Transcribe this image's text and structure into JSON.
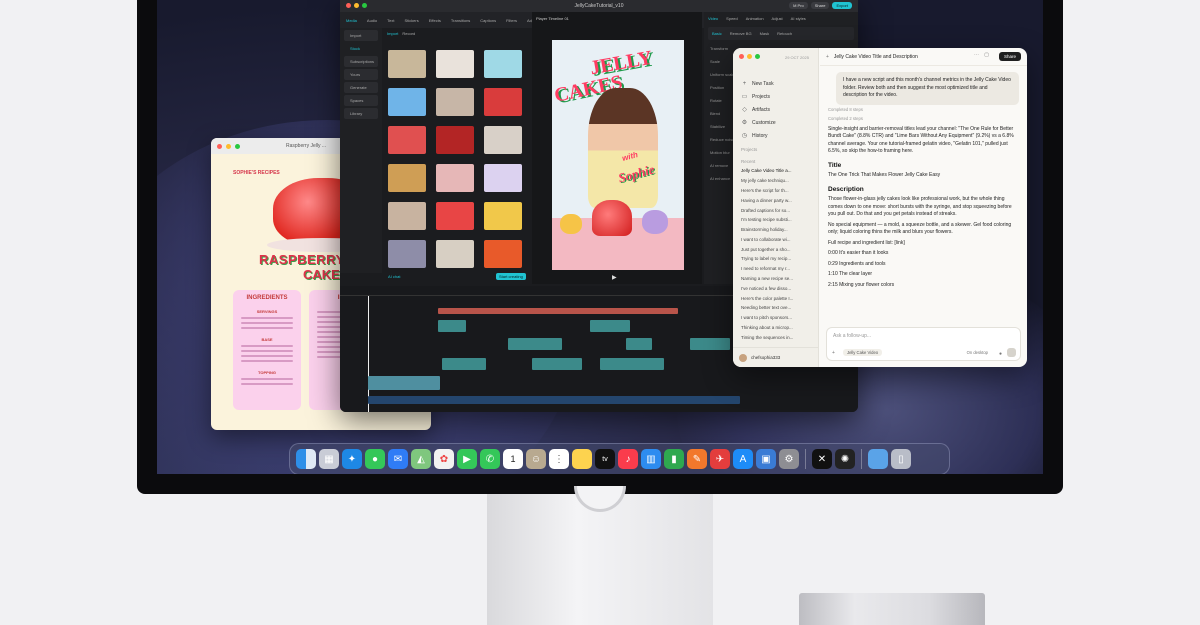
{
  "recipe_window": {
    "title": "Raspberry Jelly ...",
    "brand": "SOPHIE'S RECIPES",
    "heading_line1": "RASPBERRY",
    "heading_line2": "CAKE REC",
    "card1_title": "INGREDIENTS",
    "card1_sub1": "SERVINGS",
    "card1_sub2": "BASE",
    "card1_sub3": "TOPPING",
    "card2_title": "ING"
  },
  "editor_window": {
    "title": "JellyCakeTutorial_v10",
    "top_buttons": [
      "M Pro",
      "Share",
      "Export"
    ],
    "toolbar": [
      "Media",
      "Audio",
      "Text",
      "Stickers",
      "Effects",
      "Transitions",
      "Captions",
      "Filters",
      "Adjustment",
      "Templates"
    ],
    "left_nav": [
      "Import",
      "Stock",
      "Subscriptions",
      "Yours",
      "Generate",
      "Spaces",
      "Library"
    ],
    "media_tabs": [
      "Import",
      "Record"
    ],
    "player_title": "Player Timeline 01",
    "inspector_tabs": [
      "Video",
      "Speed",
      "Animation",
      "Adjust",
      "AI styles"
    ],
    "inspector_sub": [
      "Basic",
      "Remove BG",
      "Mask",
      "Retouch"
    ],
    "inspector_rows": [
      "Transform",
      "Scale",
      "Uniform scale",
      "Position",
      "Rotate",
      "Blend",
      "Stabilize",
      "Reduce noise",
      "Motion blur",
      "AI remove",
      "AI enhance",
      "Relight"
    ],
    "ai_chat": "AI chat",
    "start_creating": "Start creating",
    "video_title": "JELLY CAKES",
    "video_subtitle_with": "with",
    "video_subtitle_name": "Sophie"
  },
  "chat_window": {
    "date": "29 OCT 2025",
    "title": "Jelly Cake Video Title and Description",
    "share": "Share",
    "nav": [
      "New Task",
      "Projects",
      "Artifacts",
      "Customize",
      "History"
    ],
    "projects_label": "Projects",
    "recent_label": "Recent",
    "recent": [
      "Jelly Cake Video Title a...",
      "My jelly cake techniqu...",
      "Here's the script for th...",
      "Having a dinner party w...",
      "Drafted captions for so...",
      "I'm testing recipe substi...",
      "Brainstorming holiday...",
      "I want to collaborate wi...",
      "Just put together a sho...",
      "Trying to label my recip...",
      "I need to reformat my r...",
      "Naming a new recipe se...",
      "I've noticed a few disso...",
      "Here's the color palette I...",
      "Needing better text ove...",
      "I want to pitch sponsors...",
      "Thinking about a microp...",
      "Timing the sequences in..."
    ],
    "username": "chefsophia333",
    "user_message": "I have a new script and this month's channel metrics in the Jelly Cake Video folder. Review both and then suggest the most optimized title and description for the video.",
    "meta1": "Completed 8 steps",
    "meta2": "Completed 2 steps",
    "para1": "Single-insight and barrier-removal titles lead your channel: \"The One Rule for Better Bundt Cake\" (8.8% CTR) and \"Lime Bars Without Any Equipment\" (9.2%) vs a 6.8% channel average. Your one tutorial-framed gelatin video, \"Gelatin 101,\" pulled just 6.5%, so skip the how-to framing here.",
    "title_heading": "Title",
    "title_text": "The One Trick That Makes Flower Jelly Cake Easy",
    "desc_heading": "Description",
    "desc1": "Those flower-in-glass jelly cakes look like professional work, but the whole thing comes down to one move: short bursts with the syringe, and stop squeezing before you pull out. Do that and you get petals instead of streaks.",
    "desc2": "No special equipment — a mold, a squeeze bottle, and a skewer. Gel food coloring only; liquid coloring thins the milk and blurs your flowers.",
    "desc3": "Full recipe and ingredient list: [link]",
    "desc4": "0:00 It's easier than it looks",
    "desc5": "0:29 Ingredients and tools",
    "desc6": "1:10 The clear layer",
    "desc7": "2:15 Mixing your flower colors",
    "follow_placeholder": "Ask a follow-up...",
    "project_chip": "Jelly Cake Video",
    "model": "On desktop"
  },
  "dock": {
    "apps": [
      "Finder",
      "Launchpad",
      "Safari",
      "Messages",
      "Mail",
      "Maps",
      "Photos",
      "FaceTime",
      "Phone",
      "Calendar",
      "Contacts",
      "Reminders",
      "Notes",
      "TV",
      "Music",
      "Keynote",
      "Numbers",
      "Pages",
      "Rocket",
      "App Store",
      "Preview",
      "Settings",
      "CapCut",
      "Claude",
      "Downloads",
      "Trash"
    ],
    "calendar_day": "1"
  }
}
